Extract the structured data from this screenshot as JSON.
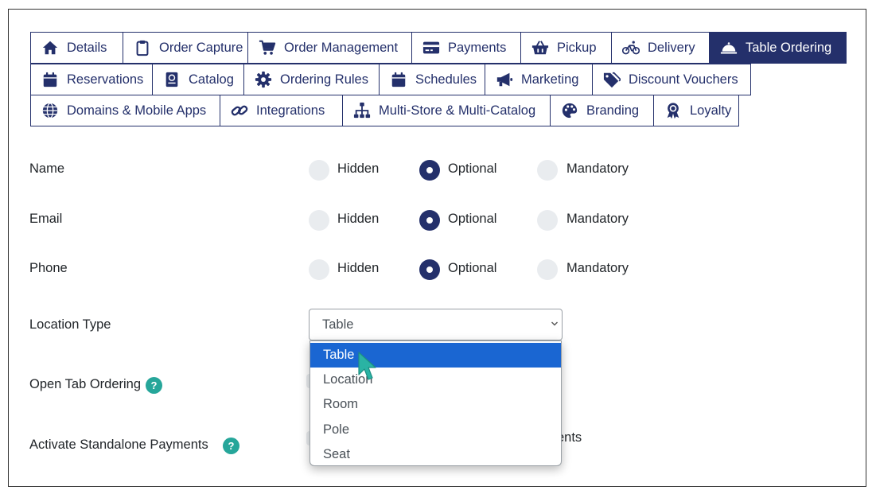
{
  "tabs": [
    {
      "label": "Details",
      "icon": "home-icon"
    },
    {
      "label": "Order Capture",
      "icon": "clipboard-icon"
    },
    {
      "label": "Order Management",
      "icon": "cart-icon"
    },
    {
      "label": "Payments",
      "icon": "credit-card-icon"
    },
    {
      "label": "Pickup",
      "icon": "basket-icon"
    },
    {
      "label": "Delivery",
      "icon": "bicycle-icon"
    },
    {
      "label": "Table Ordering",
      "icon": "cloche-icon",
      "active": true
    },
    {
      "label": "Reservations",
      "icon": "calendar-icon"
    },
    {
      "label": "Catalog",
      "icon": "book-icon"
    },
    {
      "label": "Ordering Rules",
      "icon": "gear-icon"
    },
    {
      "label": "Schedules",
      "icon": "calendar-icon"
    },
    {
      "label": "Marketing",
      "icon": "megaphone-icon"
    },
    {
      "label": "Discount Vouchers",
      "icon": "tags-icon"
    },
    {
      "label": "Domains & Mobile Apps",
      "icon": "globe-icon"
    },
    {
      "label": "Integrations",
      "icon": "link-icon"
    },
    {
      "label": "Multi-Store & Multi-Catalog",
      "icon": "sitemap-icon"
    },
    {
      "label": "Branding",
      "icon": "palette-icon"
    },
    {
      "label": "Loyalty",
      "icon": "award-icon"
    }
  ],
  "radio_options": [
    "Hidden",
    "Optional",
    "Mandatory"
  ],
  "fields": [
    {
      "label": "Name",
      "selected": "Optional"
    },
    {
      "label": "Email",
      "selected": "Optional"
    },
    {
      "label": "Phone",
      "selected": "Optional"
    }
  ],
  "location_type": {
    "label": "Location Type",
    "value": "Table",
    "options": [
      "Table",
      "Location",
      "Room",
      "Pole",
      "Seat"
    ],
    "highlighted": "Table"
  },
  "open_tab_ordering": {
    "label": "Open Tab Ordering",
    "help": "?"
  },
  "standalone_payments": {
    "label": "Activate Standalone Payments",
    "help": "?",
    "partial_text": "ents"
  },
  "colors": {
    "primary": "#24306b",
    "highlight": "#1a66d2",
    "help": "#26a69a",
    "cursor": "#2ab3a4"
  }
}
